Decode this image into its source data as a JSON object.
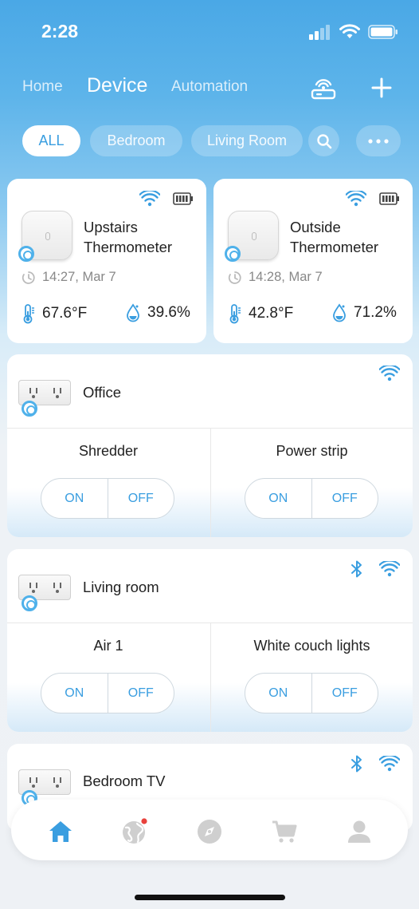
{
  "status": {
    "time": "2:28"
  },
  "nav": {
    "tabs": [
      {
        "label": "Home"
      },
      {
        "label": "Device"
      },
      {
        "label": "Automation"
      }
    ]
  },
  "filters": [
    {
      "label": "ALL"
    },
    {
      "label": "Bedroom"
    },
    {
      "label": "Living Room"
    }
  ],
  "thermometers": [
    {
      "name": "Upstairs Thermometer",
      "time": "14:27,  Mar 7",
      "temperature": "67.6°F",
      "humidity": "39.6%"
    },
    {
      "name": "Outside Thermometer",
      "time": "14:28,  Mar 7",
      "temperature": "42.8°F",
      "humidity": "71.2%"
    }
  ],
  "groups": [
    {
      "title": "Office",
      "switches": [
        {
          "label": "Shredder",
          "on": "ON",
          "off": "OFF"
        },
        {
          "label": "Power strip",
          "on": "ON",
          "off": "OFF"
        }
      ]
    },
    {
      "title": "Living room",
      "switches": [
        {
          "label": "Air 1",
          "on": "ON",
          "off": "OFF"
        },
        {
          "label": "White couch lights",
          "on": "ON",
          "off": "OFF"
        }
      ]
    },
    {
      "title": "Bedroom TV"
    }
  ],
  "colors": {
    "accent": "#3a9ee0",
    "header": "#4aa8e6",
    "notification": "#e8413c"
  },
  "bottom_nav": [
    "home-icon",
    "globe-icon",
    "compass-icon",
    "cart-icon",
    "profile-icon"
  ]
}
